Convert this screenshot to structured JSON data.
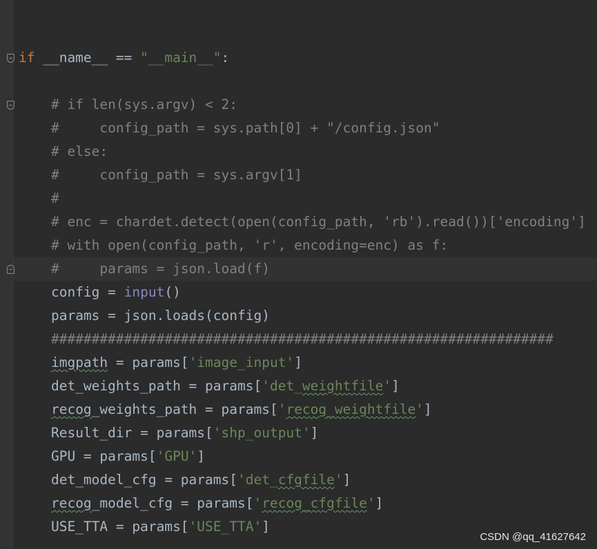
{
  "editor": {
    "lines": [
      {
        "indent": "",
        "tokens": []
      },
      {
        "indent": "",
        "tokens": [
          {
            "t": "if",
            "c": "kw"
          },
          {
            "t": " __name__ == "
          },
          {
            "t": "\"__main__\"",
            "c": "str"
          },
          {
            "t": ":"
          }
        ]
      },
      {
        "indent": "",
        "tokens": []
      },
      {
        "indent": "    ",
        "tokens": [
          {
            "t": "# if len(sys.argv) < 2:",
            "c": "cmt"
          }
        ]
      },
      {
        "indent": "    ",
        "tokens": [
          {
            "t": "#     config_path = sys.path[0] + \"/config.json\"",
            "c": "cmt"
          }
        ]
      },
      {
        "indent": "    ",
        "tokens": [
          {
            "t": "# else:",
            "c": "cmt"
          }
        ]
      },
      {
        "indent": "    ",
        "tokens": [
          {
            "t": "#     config_path = sys.argv[1]",
            "c": "cmt"
          }
        ]
      },
      {
        "indent": "    ",
        "tokens": [
          {
            "t": "#",
            "c": "cmt"
          }
        ]
      },
      {
        "indent": "    ",
        "tokens": [
          {
            "t": "# enc = chardet.detect(open(config_path, 'rb').read())['encoding']",
            "c": "cmt"
          }
        ]
      },
      {
        "indent": "    ",
        "tokens": [
          {
            "t": "# with open(config_path, 'r', encoding=enc) as f:",
            "c": "cmt"
          }
        ]
      },
      {
        "indent": "    ",
        "tokens": [
          {
            "t": "#     params = json.load(f)",
            "c": "cmt"
          }
        ],
        "current": true
      },
      {
        "indent": "    ",
        "tokens": [
          {
            "t": "config = "
          },
          {
            "t": "input",
            "c": "builtin"
          },
          {
            "t": "()"
          }
        ]
      },
      {
        "indent": "    ",
        "tokens": [
          {
            "t": "params = json.loads(config)"
          }
        ]
      },
      {
        "indent": "    ",
        "tokens": [
          {
            "t": "##############################################################",
            "c": "cmt"
          }
        ]
      },
      {
        "indent": "    ",
        "tokens": [
          {
            "t": "imgpath",
            "typo": true
          },
          {
            "t": " = params["
          },
          {
            "t": "'image_input'",
            "c": "str"
          },
          {
            "t": "]"
          }
        ]
      },
      {
        "indent": "    ",
        "tokens": [
          {
            "t": "det_weights_path = params["
          },
          {
            "t": "'det_",
            "c": "str"
          },
          {
            "t": "weightfile",
            "c": "str",
            "typo": true
          },
          {
            "t": "'",
            "c": "str"
          },
          {
            "t": "]"
          }
        ]
      },
      {
        "indent": "    ",
        "tokens": [
          {
            "t": "recog",
            "typo": true
          },
          {
            "t": "_weights_path = params["
          },
          {
            "t": "'",
            "c": "str"
          },
          {
            "t": "recog_weightfile",
            "c": "str",
            "typo": true
          },
          {
            "t": "'",
            "c": "str"
          },
          {
            "t": "]"
          }
        ]
      },
      {
        "indent": "    ",
        "tokens": [
          {
            "t": "Result_dir = params["
          },
          {
            "t": "'shp_output'",
            "c": "str"
          },
          {
            "t": "]"
          }
        ]
      },
      {
        "indent": "    ",
        "tokens": [
          {
            "t": "GPU = params["
          },
          {
            "t": "'GPU'",
            "c": "str"
          },
          {
            "t": "]"
          }
        ]
      },
      {
        "indent": "    ",
        "tokens": [
          {
            "t": "det_model_cfg = params["
          },
          {
            "t": "'det_",
            "c": "str"
          },
          {
            "t": "cfgfile",
            "c": "str",
            "typo": true
          },
          {
            "t": "'",
            "c": "str"
          },
          {
            "t": "]"
          }
        ]
      },
      {
        "indent": "    ",
        "tokens": [
          {
            "t": "recog",
            "typo": true
          },
          {
            "t": "_model_cfg = params["
          },
          {
            "t": "'",
            "c": "str"
          },
          {
            "t": "recog_cfgfile",
            "c": "str",
            "typo": true
          },
          {
            "t": "'",
            "c": "str"
          },
          {
            "t": "]"
          }
        ]
      },
      {
        "indent": "    ",
        "tokens": [
          {
            "t": "USE_TTA = params["
          },
          {
            "t": "'USE_TTA'",
            "c": "str"
          },
          {
            "t": "]"
          }
        ]
      }
    ]
  },
  "gutter": {
    "fold_markers": [
      {
        "line": 1,
        "kind": "open",
        "icon": "fold-open-icon"
      },
      {
        "line": 3,
        "kind": "open",
        "icon": "fold-open-icon"
      },
      {
        "line": 10,
        "kind": "close",
        "icon": "fold-close-icon"
      }
    ]
  },
  "watermark": {
    "text": "CSDN @qq_41627642"
  },
  "colors": {
    "background": "#2b2b2b",
    "keyword": "#cc7832",
    "string": "#6a8759",
    "comment": "#808080",
    "builtin": "#8888c6",
    "identifier": "#a9b7c6"
  }
}
